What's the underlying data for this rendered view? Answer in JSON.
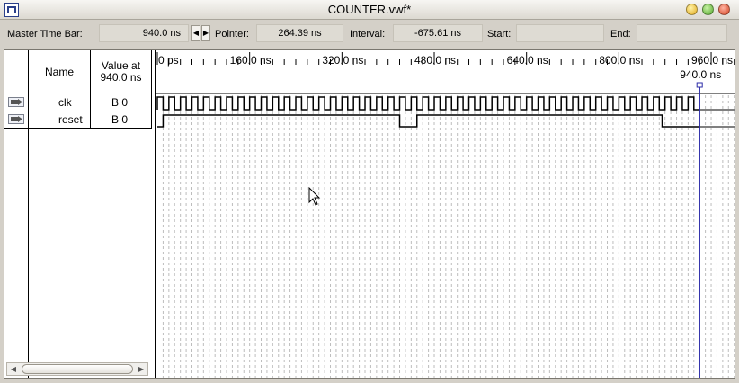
{
  "window": {
    "title": "COUNTER.vwf*"
  },
  "toolbar": {
    "master_time_bar_label": "Master Time Bar:",
    "master_time_bar_value": "940.0 ns",
    "pointer_label": "Pointer:",
    "pointer_value": "264.39 ns",
    "interval_label": "Interval:",
    "interval_value": "-675.61 ns",
    "start_label": "Start:",
    "start_value": "",
    "end_label": "End:",
    "end_value": ""
  },
  "grid": {
    "name_header": "Name",
    "value_header_line1": "Value at",
    "value_header_line2": "940.0 ns",
    "signals": [
      {
        "name": "clk",
        "value": "B 0"
      },
      {
        "name": "reset",
        "value": "B 0"
      }
    ]
  },
  "timeline": {
    "tick_labels": [
      "0 ps",
      "160.0 ns",
      "320.0 ns",
      "480.0 ns",
      "640.0 ns",
      "800.0 ns",
      "960.0 ns"
    ],
    "marker_label": "940.0 ns"
  },
  "colors": {
    "marker_line": "#2b2ba8",
    "grid_dash": "#bdbdbd",
    "waveform": "#000000"
  }
}
